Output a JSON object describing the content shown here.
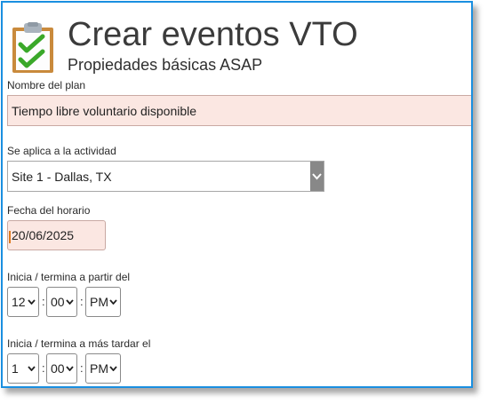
{
  "header": {
    "title": "Crear eventos VTO",
    "subtitle": "Propiedades básicas ASAP"
  },
  "plan": {
    "label": "Nombre del plan",
    "value": "Tiempo libre voluntario disponible"
  },
  "activity": {
    "label": "Se aplica a la actividad",
    "selected": "Site 1 - Dallas, TX"
  },
  "schedule": {
    "label": "Fecha del horario",
    "value": "20/06/2025"
  },
  "start": {
    "label": "Inicia / termina a partir del",
    "hour": "12",
    "minute": "00",
    "ampm": "PM",
    "separator": ":"
  },
  "end": {
    "label": "Inicia / termina a más tardar el",
    "hour": "1",
    "minute": "00",
    "ampm": "PM",
    "separator": ":"
  },
  "colors": {
    "frame_border": "#1a8fe0",
    "invalid_field_bg": "#fbe7e2",
    "icon_check": "#3aa829",
    "icon_board": "#c98a3c"
  },
  "icons": {
    "header": "clipboard-check-icon",
    "dropdown": "chevron-down-icon"
  }
}
